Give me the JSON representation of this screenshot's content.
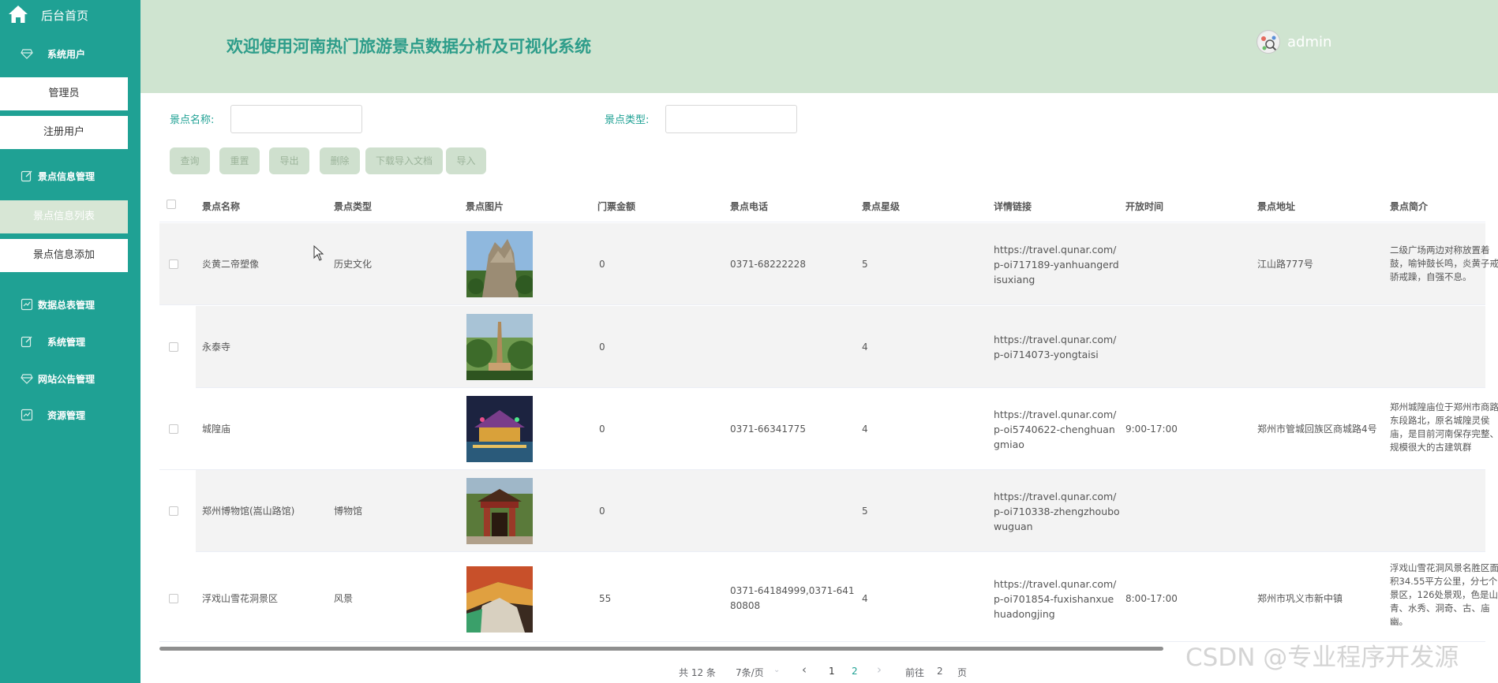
{
  "sidebar": {
    "home": "后台首页",
    "groups": [
      {
        "label": "系统用户",
        "icon": "gem-icon"
      },
      {
        "label": "景点信息管理",
        "icon": "edit-icon"
      },
      {
        "label": "数据总表管理",
        "icon": "chart-icon"
      },
      {
        "label": "系统管理",
        "icon": "edit-icon"
      },
      {
        "label": "网站公告管理",
        "icon": "gem-icon"
      },
      {
        "label": "资源管理",
        "icon": "chart-icon"
      }
    ],
    "sub_items": [
      {
        "label": "管理员"
      },
      {
        "label": "注册用户"
      },
      {
        "label": "景点信息列表",
        "active": true
      },
      {
        "label": "景点信息添加"
      }
    ]
  },
  "header": {
    "title": "欢迎使用河南热门旅游景点数据分析及可视化系统",
    "user": "admin"
  },
  "search": {
    "name_label": "景点名称:",
    "name_value": "",
    "type_label": "景点类型:",
    "type_value": ""
  },
  "buttons": {
    "query": "查询",
    "reset": "重置",
    "export": "导出",
    "delete": "删除",
    "download_template": "下载导入文档",
    "import": "导入"
  },
  "table": {
    "columns": [
      "景点名称",
      "景点类型",
      "景点图片",
      "门票金额",
      "景点电话",
      "景点星级",
      "详情链接",
      "开放时间",
      "景点地址",
      "景点简介"
    ],
    "rows": [
      {
        "name": "炎黄二帝塑像",
        "type": "历史文化",
        "price": "0",
        "phone": "0371-68222228",
        "star": "5",
        "link": "https://travel.qunar.com/p-oi717189-yanhuangerdisuxiang",
        "open": "",
        "address": "江山路777号",
        "intro": "二级广场两边对称放置着鼓，喻钟鼓长鸣，炎黄子戒骄戒躁，自强不息。"
      },
      {
        "name": "永泰寺",
        "type": "",
        "price": "0",
        "phone": "",
        "star": "4",
        "link": "https://travel.qunar.com/p-oi714073-yongtaisi",
        "open": "",
        "address": "",
        "intro": ""
      },
      {
        "name": "城隍庙",
        "type": "",
        "price": "0",
        "phone": "0371-66341775",
        "star": "4",
        "link": "https://travel.qunar.com/p-oi5740622-chenghuangmiao",
        "open": "9:00-17:00",
        "address": "郑州市管城回族区商城路4号",
        "intro": "郑州城隍庙位于郑州市商路东段路北，原名城隍灵侯庙，是目前河南保存完整、规模很大的古建筑群"
      },
      {
        "name": "郑州博物馆(嵩山路馆)",
        "type": "博物馆",
        "price": "0",
        "phone": "",
        "star": "5",
        "link": "https://travel.qunar.com/p-oi710338-zhengzhoubowuguan",
        "open": "",
        "address": "",
        "intro": ""
      },
      {
        "name": "浮戏山雪花洞景区",
        "type": "风景",
        "price": "55",
        "phone": "0371-64184999,0371-64180808",
        "star": "4",
        "link": "https://travel.qunar.com/p-oi701854-fuxishanxuehuadongjing",
        "open": "8:00-17:00",
        "address": "郑州市巩义市新中镇",
        "intro": "浮戏山雪花洞风景名胜区面积34.55平方公里，分七个景区，126处景观，色是山青、水秀、洞奇、古、庙幽。"
      }
    ]
  },
  "pagination": {
    "total": "共 12 条",
    "page_size": "7条/页",
    "prev": "‹",
    "pages": [
      "1",
      "2"
    ],
    "current": "1",
    "next": "›",
    "goto_label": "前往",
    "goto_value": "2",
    "page_suffix": "页"
  },
  "watermark": "CSDN @专业程序开发源",
  "colors": {
    "sidebar": "#1fa194",
    "header": "#cfe4d0",
    "title": "#2e9d8a",
    "button": "#cfe0ce"
  }
}
